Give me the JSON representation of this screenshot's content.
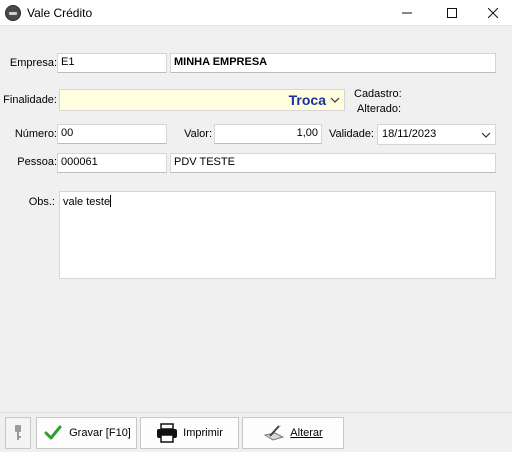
{
  "window": {
    "title": "Vale Crédito",
    "app_icon": "app-logo-icon",
    "minimize_icon": "minimize-icon",
    "maximize_icon": "maximize-icon",
    "close_icon": "close-icon"
  },
  "form": {
    "empresa_label": "Empresa:",
    "empresa_code": "E1",
    "empresa_name": "MINHA EMPRESA",
    "finalidade_label": "Finalidade:",
    "finalidade_value": "Troca",
    "cadastro_label": "Cadastro:",
    "alterado_label": "Alterado:",
    "numero_label": "Número:",
    "numero_value": "00",
    "valor_label": "Valor:",
    "valor_value": "1,00",
    "validade_label": "Validade:",
    "validade_value": "18/11/2023",
    "pessoa_label": "Pessoa:",
    "pessoa_code": "000061",
    "pessoa_name": "PDV TESTE",
    "obs_label": "Obs.:",
    "obs_value": "vale teste"
  },
  "toolbar": {
    "key_icon": "key-icon",
    "gravar_label": "Gravar [F10]",
    "gravar_icon": "checkmark-icon",
    "imprimir_label": "Imprimir",
    "imprimir_icon": "printer-icon",
    "alterar_label": "Alterar",
    "alterar_icon": "edit-icon"
  },
  "colors": {
    "finalidade_bg": "#ffffe0",
    "finalidade_text": "#1a2ea0",
    "check_green": "#2e9e2e"
  }
}
